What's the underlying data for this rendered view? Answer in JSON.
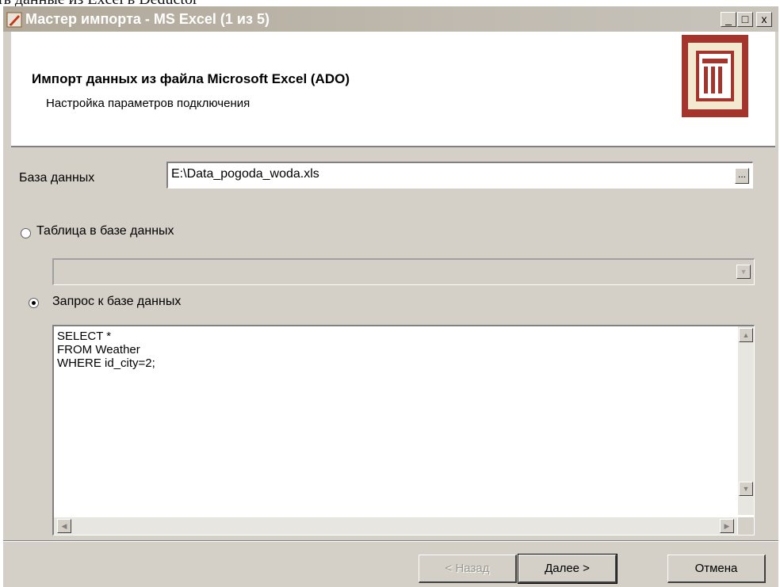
{
  "document": {
    "caption_fragment": "ть данные из Excel в Deductor"
  },
  "window": {
    "title": "Мастер импорта - MS Excel (1 из 5)",
    "controls": {
      "minimize": "_",
      "maximize": "□",
      "close": "x"
    }
  },
  "header": {
    "title": "Импорт данных из файла Microsoft Excel (ADO)",
    "subtitle": "Настройка параметров подключения",
    "logo_icon": "table-logo-icon"
  },
  "form": {
    "database_label": "База данных",
    "database_value": "E:\\Data_pogoda_woda.xls",
    "browse_label": "...",
    "option_table_label": "Таблица в базе данных",
    "option_table_selected": false,
    "table_combo_value": "",
    "option_query_label": "Запрос к базе данных",
    "option_query_selected": true,
    "query_text": "SELECT *\nFROM Weather\nWHERE id_city=2;"
  },
  "buttons": {
    "back": "< Назад",
    "next": "Далее >",
    "cancel": "Отмена"
  },
  "colors": {
    "dialog_bg": "#d4d0c8",
    "logo_frame": "#a3352d",
    "logo_bg": "#f3e8d0"
  }
}
